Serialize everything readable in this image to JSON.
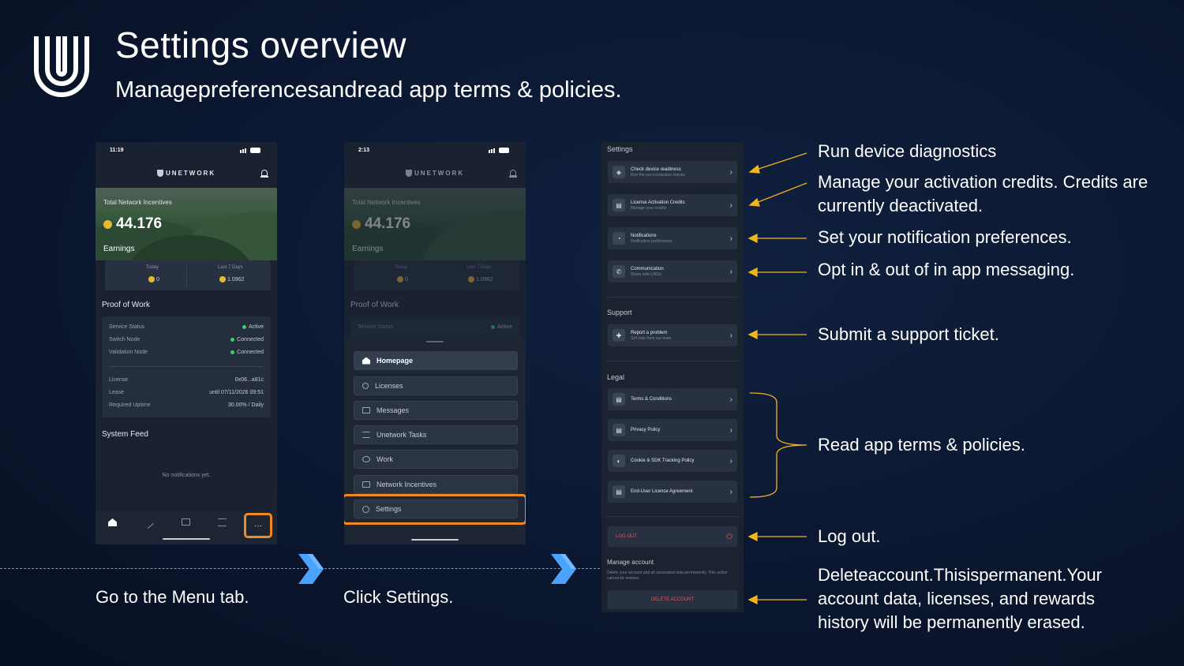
{
  "header": {
    "title": "Settings overview",
    "subtitle": "Managepreferencesandread app terms & policies."
  },
  "phone1": {
    "time": "11:19",
    "brand": "UNETWORK",
    "hero_label": "Total Network Incentives",
    "hero_value": "44.176",
    "earnings_label": "Earnings",
    "today_label": "Today",
    "today_value": "0",
    "last7_label": "Last 7 Days",
    "last7_value": "1.0962",
    "proof_title": "Proof of Work",
    "rows": [
      {
        "label": "Service Status",
        "value": "Active"
      },
      {
        "label": "Switch Node",
        "value": "Connected"
      },
      {
        "label": "Validation Node",
        "value": "Connected"
      }
    ],
    "license_label": "License",
    "license_value": "0x06...a81c",
    "lease_label": "Lease",
    "lease_value": "until 07/11/2026 09:51",
    "uptime_label": "Required Uptime",
    "uptime_value": "30.00% / Daily",
    "feed_title": "System Feed",
    "feed_empty": "No notifications yet.",
    "more_glyph": "···"
  },
  "phone2": {
    "time": "2:13",
    "brand": "UNETWORK",
    "hero_label": "Total Network Incentives",
    "hero_value": "44.176",
    "earnings_label": "Earnings",
    "today_label": "Today",
    "today_value": "0",
    "last7_label": "Last 7 Days",
    "last7_value": "1.0962",
    "proof_title": "Proof of Work",
    "service_label": "Service Status",
    "service_value": "Active",
    "menu": [
      "Homepage",
      "Licenses",
      "Messages",
      "Unetwork Tasks",
      "Work",
      "Network Incentives",
      "Settings"
    ]
  },
  "phone3": {
    "settings_title": "Settings",
    "settings_items": [
      {
        "title": "Check device readiness",
        "sub": "Run the pre-connection checks"
      },
      {
        "title": "License Activation Credits",
        "sub": "Manage your credits"
      },
      {
        "title": "Notifications",
        "sub": "Notification preferences"
      },
      {
        "title": "Communication",
        "sub": "Share with UNOs"
      }
    ],
    "support_title": "Support",
    "support_items": [
      {
        "title": "Report a problem",
        "sub": "Get help from our team"
      }
    ],
    "legal_title": "Legal",
    "legal_items": [
      "Terms & Conditions",
      "Privacy Policy",
      "Cookie & SDK Tracking Policy",
      "End-User Licence Agreement"
    ],
    "logout_label": "LOG OUT",
    "manage_title": "Manage account",
    "manage_desc": "Delete your account and all associated data permanently. This action cannot be undone.",
    "delete_label": "DELETE ACCOUNT"
  },
  "captions": {
    "step1": "Go to the Menu tab.",
    "step2": "Click Settings."
  },
  "annotations": [
    "Run device diagnostics",
    "Manage your activation credits. Credits are currently deactivated.",
    "Set your notification preferences.",
    "Opt in & out of in app messaging.",
    "Submit a support ticket.",
    "Read app terms & policies.",
    "Log out.",
    "Deleteaccount.Thisispermanent.Your account data, licenses, and rewards history will be permanently erased."
  ],
  "colors": {
    "accent_orange": "#f08a24",
    "annotation_arrow": "#f2b51d",
    "chevron_blue": "#4aa3ff",
    "status_green": "#3ecf6a",
    "coin_gold": "#e8b92b"
  },
  "icons": [
    "unetwork-logo-icon",
    "bell-icon",
    "home-icon",
    "key-icon",
    "message-icon",
    "tasks-icon",
    "more-icon",
    "gear-icon",
    "shield-icon",
    "document-icon",
    "logout-icon",
    "chevron-right-icon"
  ]
}
